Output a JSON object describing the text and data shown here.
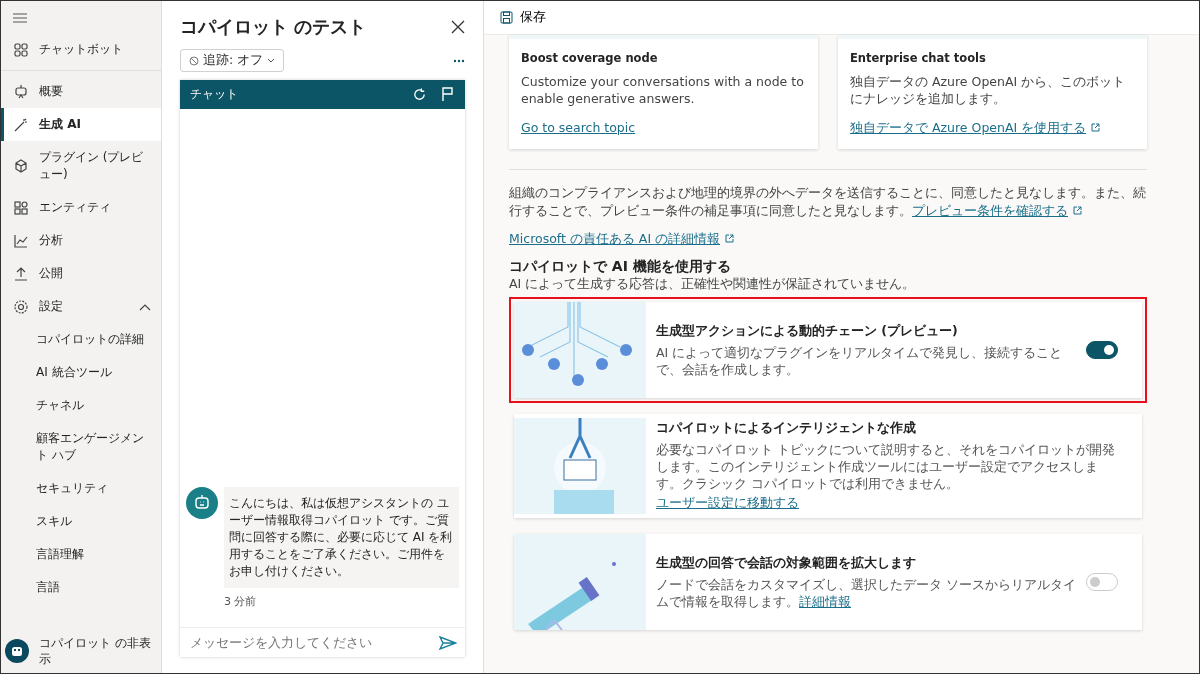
{
  "sidebar": {
    "items": [
      {
        "label": "チャットボット",
        "selected": false
      },
      {
        "label": "概要",
        "selected": false
      },
      {
        "label": "生成 AI",
        "selected": true
      },
      {
        "label": "プラグイン (プレビュー)",
        "selected": false
      },
      {
        "label": "エンティティ",
        "selected": false
      },
      {
        "label": "分析",
        "selected": false
      },
      {
        "label": "公開",
        "selected": false
      },
      {
        "label": "設定",
        "selected": false,
        "expanded": true,
        "children": [
          {
            "label": "コパイロットの詳細",
            "selected": false
          },
          {
            "label": "AI 統合ツール",
            "selected": false
          },
          {
            "label": "チャネル",
            "selected": false
          },
          {
            "label": "顧客エンゲージメント ハブ",
            "selected": false
          },
          {
            "label": "セキュリティ",
            "selected": false
          },
          {
            "label": "スキル",
            "selected": false
          },
          {
            "label": "言語理解",
            "selected": false
          },
          {
            "label": "言語",
            "selected": false
          }
        ]
      }
    ],
    "footer": "コパイロット の非表示"
  },
  "test_panel": {
    "title": "コパイロット のテスト",
    "tracking": "追跡: オフ",
    "chat_title": "チャット",
    "messages": [
      {
        "text": "こんにちは、私は仮想アシスタントの ユーザー情報取得コパイロット です。ご質問に回答する際に、必要に応じて AI を利用することをご了承ください。ご用件をお申し付けください。",
        "time": "3 分前"
      }
    ],
    "input": {
      "placeholder": "メッセージを入力してください"
    }
  },
  "toolbar": {
    "save": "保存"
  },
  "top_cards": [
    {
      "title": "Boost coverage node",
      "description": "Customize your conversations with a node to enable generative answers.",
      "link": "Go to search topic",
      "external": false
    },
    {
      "title": "Enterprise chat tools",
      "description": "独自データの Azure OpenAI から、このボットにナレッジを追加します。",
      "link": "独自データで Azure OpenAI を使用する",
      "external": true
    }
  ],
  "notice": {
    "text": "組織のコンプライアンスおよび地理的境界の外へデータを送信することに、同意したと見なします。また、続行することで、プレビュー条件の補足事項に同意したと見なします。",
    "link": "プレビュー条件を確認する"
  },
  "responsible_ai_link": "Microsoft の責任ある AI の詳細情報",
  "section": {
    "title": "コパイロットで AI 機能を使用する",
    "subtitle": "AI によって生成する応答は、正確性や関連性が保証されていません。"
  },
  "features": [
    {
      "kind": "toggle",
      "title": "生成型アクションによる動的チェーン (プレビュー)",
      "description": "AI によって適切なプラグインをリアルタイムで発見し、接続することで、会話を作成します。",
      "on": true,
      "highlighted": true
    },
    {
      "kind": "plain",
      "title": "コパイロットによるインテリジェントな作成",
      "description": "必要なコパイロット トピックについて説明すると、それをコパイロットが開発します。このインテリジェント作成ツールにはユーザー設定でアクセスします。クラシック コパイロットでは利用できません。",
      "link": "ユーザー設定に移動する",
      "highlighted": false
    },
    {
      "kind": "toggle",
      "title": "生成型の回答で会話の対象範囲を拡大します",
      "description": "ノードで会話をカスタマイズし、選択したデータ ソースからリアルタイムで情報を取得します。",
      "link": "詳細情報",
      "on": false,
      "highlighted": false
    }
  ]
}
